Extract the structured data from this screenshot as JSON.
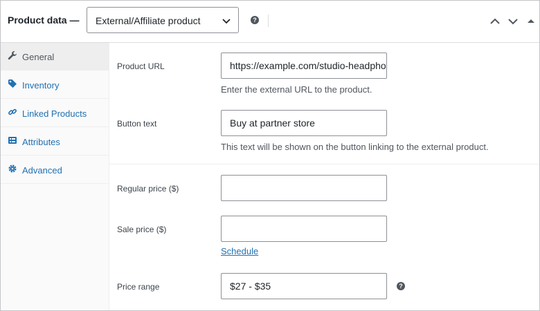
{
  "header": {
    "title": "Product data —",
    "product_type": "External/Affiliate product",
    "help_icon_text": "?"
  },
  "sidebar": {
    "items": [
      {
        "label": "General",
        "icon": "wrench-icon",
        "active": true
      },
      {
        "label": "Inventory",
        "icon": "tag-icon",
        "active": false
      },
      {
        "label": "Linked Products",
        "icon": "link-icon",
        "active": false
      },
      {
        "label": "Attributes",
        "icon": "list-icon",
        "active": false
      },
      {
        "label": "Advanced",
        "icon": "gear-icon",
        "active": false
      }
    ]
  },
  "general": {
    "product_url": {
      "label": "Product URL",
      "value": "https://example.com/studio-headphones",
      "description": "Enter the external URL to the product."
    },
    "button_text": {
      "label": "Button text",
      "value": "Buy at partner store",
      "description": "This text will be shown on the button linking to the external product."
    },
    "regular_price": {
      "label": "Regular price ($)",
      "value": ""
    },
    "sale_price": {
      "label": "Sale price ($)",
      "value": "",
      "schedule_link": "Schedule"
    },
    "price_range": {
      "label": "Price range",
      "value": "$27 - $35",
      "help_icon_text": "?"
    }
  },
  "colors": {
    "link": "#2271b1",
    "border": "#c3c4c7",
    "sidebar_bg": "#fafafa",
    "active_tab_bg": "#eeeeee"
  }
}
